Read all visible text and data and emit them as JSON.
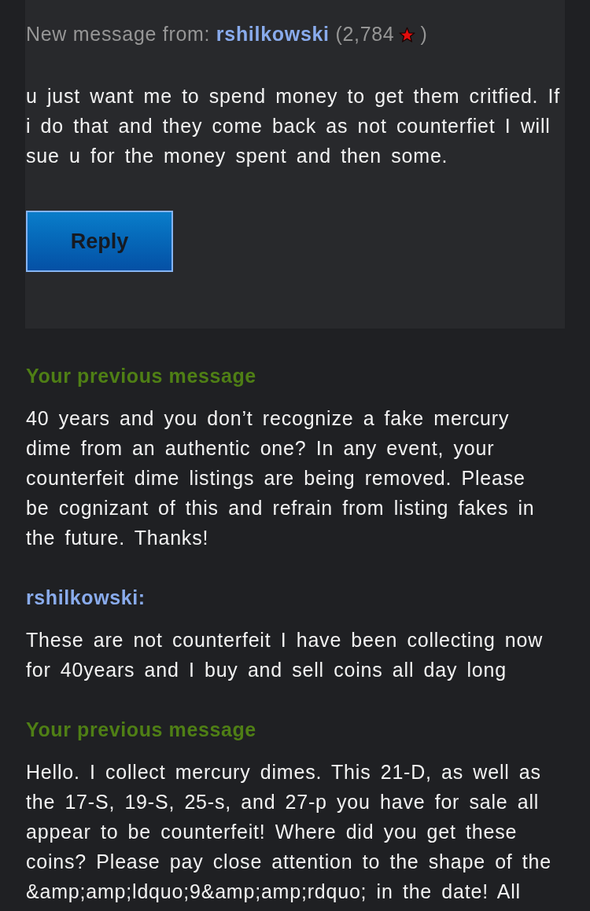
{
  "new_message": {
    "label": "New message from:",
    "username": "rshilkowski",
    "score_prefix": "(2,784",
    "score_suffix": ")",
    "text": "u just want me to spend money to get them critfied. If i do that and they come back as not counterfiet I will sue u for the money spent and then some.",
    "reply_button": "Reply"
  },
  "history": [
    {
      "kind": "sent",
      "heading": "Your previous message",
      "text": "40 years and you don’t recognize a fake mercury dime from an authentic one? In any event, your counterfeit dime listings are being removed. Please be cognizant of this and refrain from listing fakes in the future. Thanks!"
    },
    {
      "kind": "received",
      "heading": "rshilkowski:",
      "text": "These are not counterfeit I have been collecting now for 40years and I buy and sell coins all day long"
    },
    {
      "kind": "sent",
      "heading": "Your previous message",
      "text": "Hello. I collect mercury dimes. This 21-D, as well as the 17-S, 19-S, 25-s, and 27-p you have for sale all appear to be counterfeit! Where did you get these coins? Please pay close attention to the shape of the &amp;amp;ldquo;9&amp;amp;rdquo; in the date! All"
    }
  ]
}
